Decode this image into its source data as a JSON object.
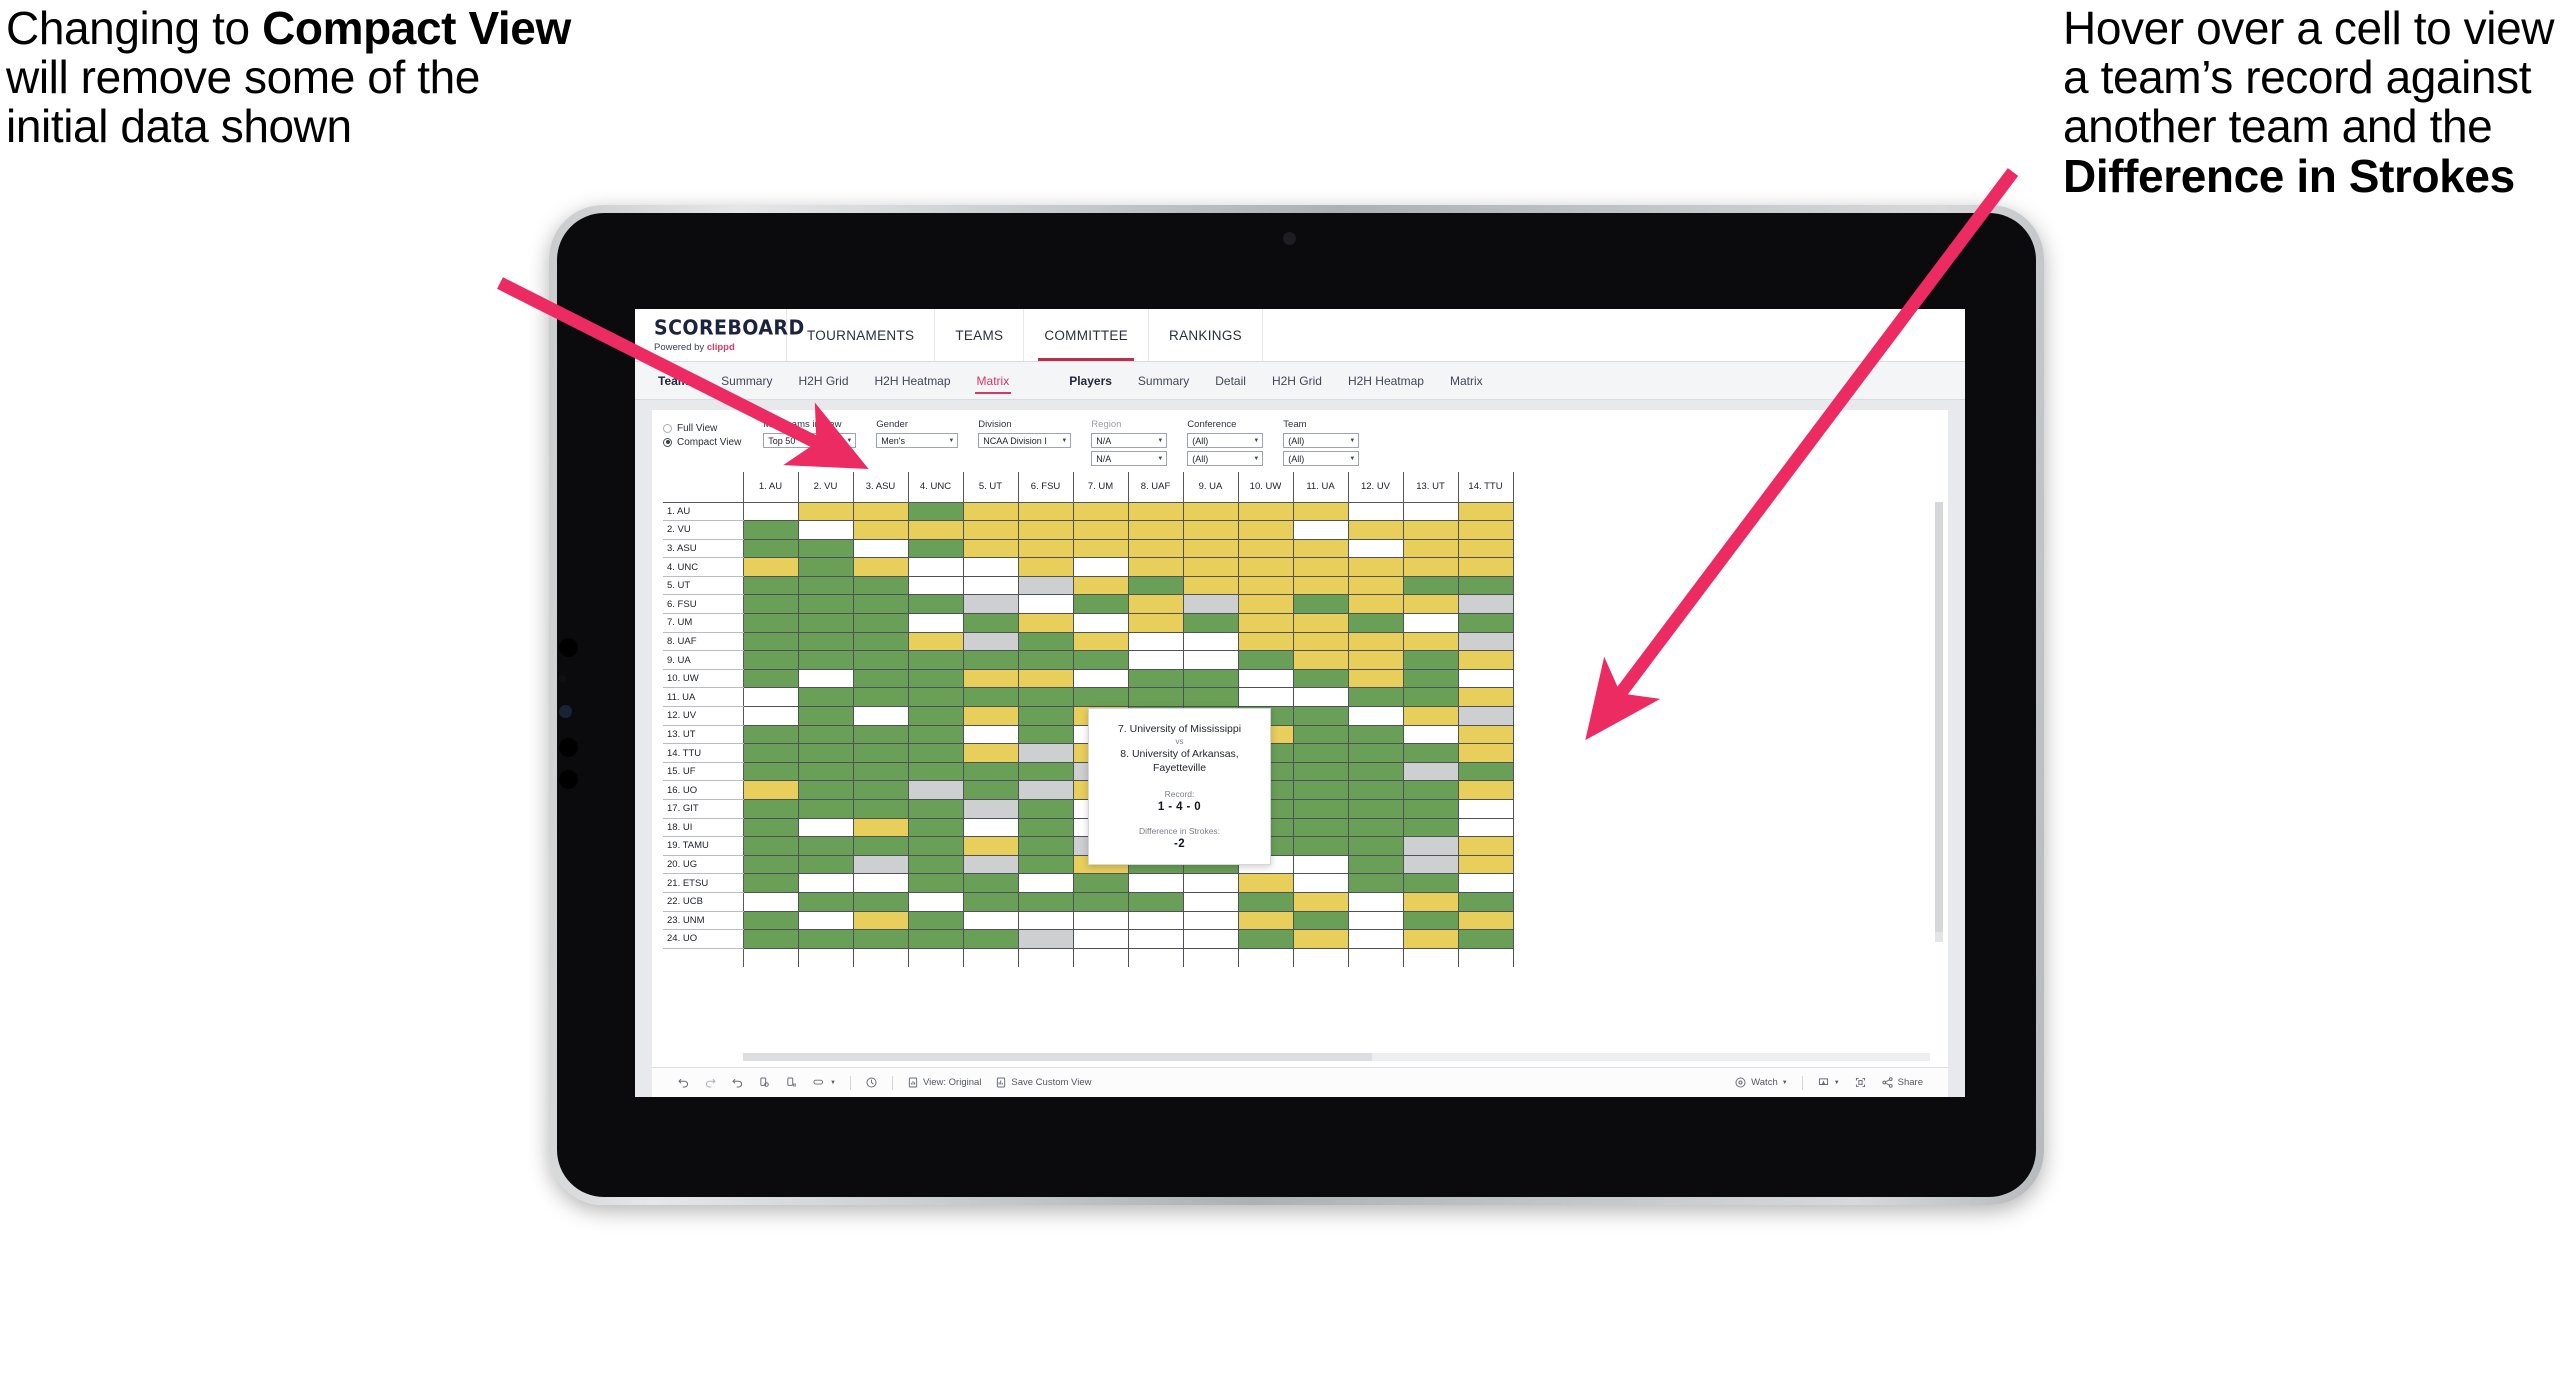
{
  "annotations": {
    "left": {
      "segments": [
        {
          "text": "Changing to ",
          "bold": false
        },
        {
          "text": "Compact View",
          "bold": true
        },
        {
          "text": " will remove some of the initial data shown",
          "bold": false
        }
      ],
      "plain": "Changing to Compact View will remove some of the initial data shown"
    },
    "right": {
      "segments": [
        {
          "text": "Hover over a cell to view a team’s record against another team and the ",
          "bold": false
        },
        {
          "text": "Difference in Strokes",
          "bold": true
        }
      ],
      "plain": "Hover over a cell to view a team’s record against another team and the Difference in Strokes"
    }
  },
  "app": {
    "brand": {
      "title": "SCOREBOARD",
      "powered_prefix": "Powered by ",
      "powered_name": "clippd"
    },
    "topnav": {
      "items": [
        {
          "label": "TOURNAMENTS",
          "active": false
        },
        {
          "label": "TEAMS",
          "active": false
        },
        {
          "label": "COMMITTEE",
          "active": true
        },
        {
          "label": "RANKINGS",
          "active": false
        }
      ]
    },
    "subnav": {
      "groups": [
        {
          "head": "Teams",
          "items": [
            "Summary",
            "H2H Grid",
            "H2H Heatmap",
            "Matrix"
          ],
          "active": "Matrix"
        },
        {
          "head": "Players",
          "items": [
            "Summary",
            "Detail",
            "H2H Grid",
            "H2H Heatmap",
            "Matrix"
          ],
          "active": ""
        }
      ]
    },
    "filters": {
      "view_mode": {
        "options": [
          {
            "label": "Full View",
            "selected": false
          },
          {
            "label": "Compact View",
            "selected": true
          }
        ]
      },
      "controls": [
        {
          "label": "Max teams in view",
          "muted": false,
          "width_class": "w-top50",
          "values": [
            "Top 50"
          ]
        },
        {
          "label": "Gender",
          "muted": false,
          "width_class": "w-gender",
          "values": [
            "Men's"
          ]
        },
        {
          "label": "Division",
          "muted": false,
          "width_class": "w-div",
          "values": [
            "NCAA Division I"
          ]
        },
        {
          "label": "Region",
          "muted": true,
          "width_class": "w-region",
          "values": [
            "N/A",
            "N/A"
          ]
        },
        {
          "label": "Conference",
          "muted": false,
          "width_class": "w-conf",
          "values": [
            "(All)",
            "(All)"
          ]
        },
        {
          "label": "Team",
          "muted": false,
          "width_class": "w-team",
          "values": [
            "(All)",
            "(All)"
          ]
        }
      ]
    },
    "matrix": {
      "columns": [
        "1. AU",
        "2. VU",
        "3. ASU",
        "4. UNC",
        "5. UT",
        "6. FSU",
        "7. UM",
        "8. UAF",
        "9. UA",
        "10. UW",
        "11. UA",
        "12. UV",
        "13. UT",
        "14. TTU"
      ],
      "rows": [
        "1. AU",
        "2. VU",
        "3. ASU",
        "4. UNC",
        "5. UT",
        "6. FSU",
        "7. UM",
        "8. UAF",
        "9. UA",
        "10. UW",
        "11. UA",
        "12. UV",
        "13. UT",
        "14. TTU",
        "15. UF",
        "16. UO",
        "17. GIT",
        "18. UI",
        "19. TAMU",
        "20. UG",
        "21. ETSU",
        "22. UCB",
        "23. UNM",
        "24. UO"
      ],
      "legend": {
        "win": "#6a9f58",
        "mixed": "#e8ce5b",
        "none": "#ffffff",
        "tie": "#cdcfd1"
      },
      "cells": [
        [
          "w",
          "y",
          "y",
          "g",
          "y",
          "y",
          "y",
          "y",
          "y",
          "y",
          "y",
          "w",
          "w",
          "y"
        ],
        [
          "g",
          "w",
          "y",
          "y",
          "y",
          "y",
          "y",
          "y",
          "y",
          "y",
          "w",
          "y",
          "y",
          "y"
        ],
        [
          "g",
          "g",
          "w",
          "g",
          "y",
          "y",
          "y",
          "y",
          "y",
          "y",
          "y",
          "w",
          "y",
          "y"
        ],
        [
          "y",
          "g",
          "y",
          "w",
          "w",
          "y",
          "w",
          "y",
          "y",
          "y",
          "y",
          "y",
          "y",
          "y"
        ],
        [
          "g",
          "g",
          "g",
          "w",
          "w",
          "s",
          "y",
          "g",
          "y",
          "y",
          "y",
          "y",
          "g",
          "g"
        ],
        [
          "g",
          "g",
          "g",
          "g",
          "s",
          "w",
          "g",
          "y",
          "s",
          "y",
          "g",
          "y",
          "y",
          "s"
        ],
        [
          "g",
          "g",
          "g",
          "w",
          "g",
          "y",
          "w",
          "y",
          "g",
          "y",
          "y",
          "g",
          "w",
          "g"
        ],
        [
          "g",
          "g",
          "g",
          "y",
          "s",
          "g",
          "y",
          "w",
          "w",
          "y",
          "y",
          "y",
          "y",
          "s"
        ],
        [
          "g",
          "g",
          "g",
          "g",
          "g",
          "g",
          "g",
          "w",
          "w",
          "g",
          "y",
          "y",
          "g",
          "y"
        ],
        [
          "g",
          "w",
          "g",
          "g",
          "y",
          "y",
          "w",
          "g",
          "g",
          "w",
          "g",
          "y",
          "g",
          "w"
        ],
        [
          "w",
          "g",
          "g",
          "g",
          "g",
          "g",
          "g",
          "g",
          "g",
          "w",
          "w",
          "g",
          "g",
          "y"
        ],
        [
          "w",
          "g",
          "w",
          "g",
          "y",
          "g",
          "y",
          "g",
          "g",
          "g",
          "g",
          "w",
          "y",
          "s"
        ],
        [
          "g",
          "g",
          "g",
          "g",
          "w",
          "g",
          "w",
          "g",
          "g",
          "y",
          "g",
          "g",
          "w",
          "y"
        ],
        [
          "g",
          "g",
          "g",
          "g",
          "y",
          "s",
          "y",
          "g",
          "g",
          "g",
          "g",
          "g",
          "g",
          "y"
        ],
        [
          "g",
          "g",
          "g",
          "g",
          "g",
          "g",
          "s",
          "g",
          "g",
          "g",
          "g",
          "g",
          "s",
          "g"
        ],
        [
          "y",
          "g",
          "g",
          "s",
          "g",
          "s",
          "y",
          "g",
          "g",
          "g",
          "g",
          "g",
          "g",
          "y"
        ],
        [
          "g",
          "g",
          "g",
          "g",
          "s",
          "g",
          "w",
          "g",
          "g",
          "g",
          "g",
          "g",
          "g",
          "w"
        ],
        [
          "g",
          "w",
          "y",
          "g",
          "w",
          "g",
          "w",
          "g",
          "g",
          "g",
          "g",
          "g",
          "g",
          "w"
        ],
        [
          "g",
          "g",
          "g",
          "g",
          "y",
          "g",
          "s",
          "g",
          "y",
          "g",
          "g",
          "g",
          "s",
          "y"
        ],
        [
          "g",
          "g",
          "s",
          "g",
          "s",
          "g",
          "y",
          "g",
          "g",
          "w",
          "w",
          "g",
          "s",
          "y"
        ],
        [
          "g",
          "w",
          "w",
          "g",
          "g",
          "w",
          "g",
          "w",
          "w",
          "y",
          "w",
          "g",
          "g",
          "w"
        ],
        [
          "w",
          "g",
          "g",
          "w",
          "g",
          "g",
          "g",
          "g",
          "w",
          "g",
          "y",
          "w",
          "y",
          "g"
        ],
        [
          "g",
          "w",
          "y",
          "g",
          "w",
          "w",
          "w",
          "w",
          "w",
          "y",
          "g",
          "w",
          "g",
          "y"
        ],
        [
          "g",
          "g",
          "g",
          "g",
          "g",
          "s",
          "w",
          "w",
          "w",
          "g",
          "y",
          "w",
          "y",
          "g"
        ]
      ]
    },
    "tooltip": {
      "team_a": "7. University of Mississippi",
      "vs": "vs",
      "team_b": "8. University of Arkansas, Fayetteville",
      "record_label": "Record:",
      "record_value": "1 - 4 - 0",
      "diff_label": "Difference in Strokes:",
      "diff_value": "-2"
    },
    "bottombar": {
      "items": [
        {
          "name": "undo-icon",
          "label": ""
        },
        {
          "name": "redo-icon",
          "label": ""
        },
        {
          "name": "revert-icon",
          "label": ""
        },
        {
          "name": "refresh-data-icon",
          "label": ""
        },
        {
          "name": "pause-refresh-icon",
          "label": ""
        },
        {
          "name": "highlight-icon",
          "label": "",
          "caret": true
        },
        {
          "name": "history-icon",
          "label": ""
        },
        {
          "name": "view-original-icon",
          "label": "View: Original"
        },
        {
          "name": "save-custom-view-icon",
          "label": "Save Custom View"
        },
        {
          "name": "watch-icon",
          "label": "Watch",
          "caret": true
        },
        {
          "name": "download-icon",
          "label": "",
          "caret": true
        },
        {
          "name": "fullscreen-icon",
          "label": ""
        },
        {
          "name": "share-icon",
          "label": "Share"
        }
      ]
    }
  }
}
